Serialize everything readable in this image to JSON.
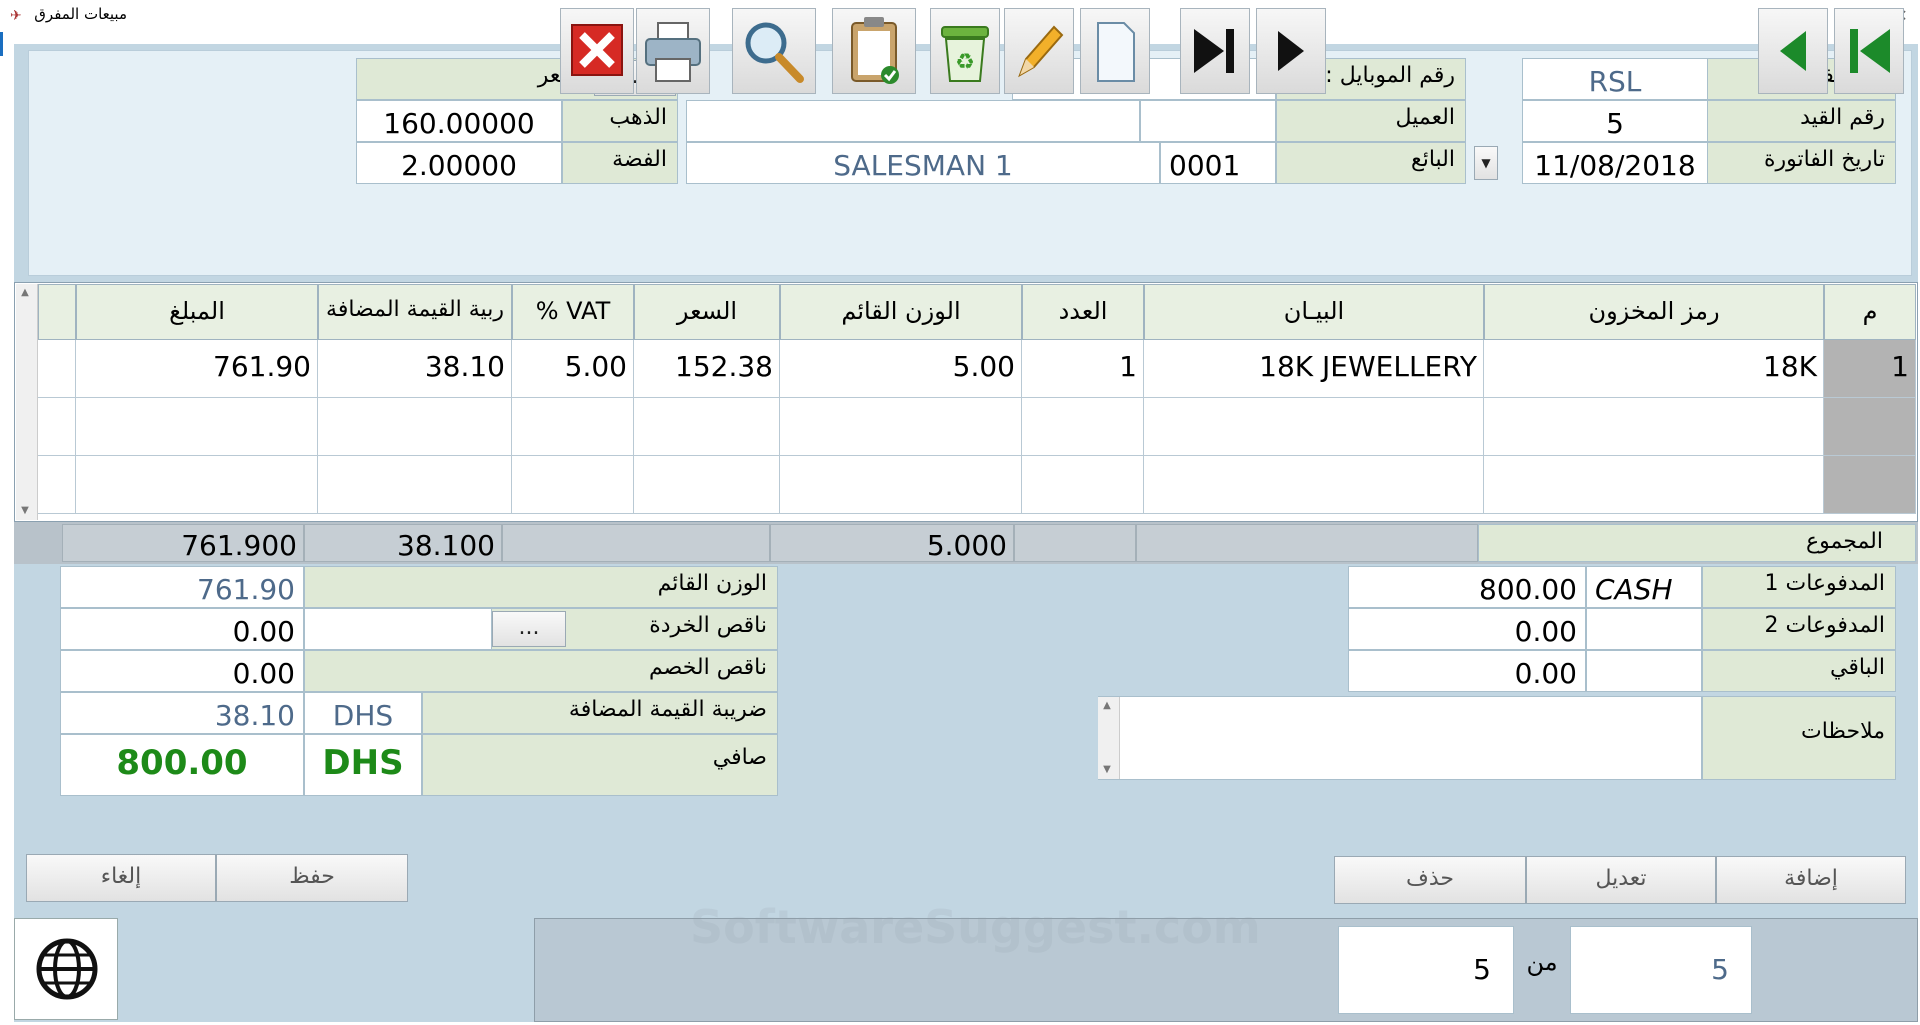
{
  "window": {
    "title": "مبيعات المفرق"
  },
  "header": {
    "invoice_type_label": "نوع الفاتورة",
    "invoice_type_value": "RSL",
    "entry_no_label": "رقم القيد",
    "entry_no_value": "5",
    "invoice_date_label": "تاريخ الفاتورة",
    "invoice_date_value": "11/08/2018",
    "mobile_label": "رقم الموبايل :",
    "mobile_value": "",
    "customer_label": "العميل",
    "customer_code": "",
    "customer_name": "",
    "seller_label": "البائع",
    "seller_code": "0001",
    "seller_name": "SALESMAN 1",
    "price_label": "السعر",
    "price_btn": "...",
    "gold_label": "الذهب",
    "gold_value": "160.00000",
    "silver_label": "الفضة",
    "silver_value": "2.00000"
  },
  "grid": {
    "columns": [
      "م",
      "رمز المخزون",
      "البيـان",
      "العدد",
      "الوزن القائم",
      "السعر",
      "VAT %",
      "ربية القيمة المضافة",
      "المبلغ"
    ],
    "rows": [
      {
        "no": "1",
        "code": "18K",
        "desc": "18K JEWELLERY",
        "qty": "1",
        "weight": "5.00",
        "price": "152.38",
        "vat_pct": "5.00",
        "vat_amt": "38.10",
        "amount": "761.90"
      },
      {
        "no": "",
        "code": "",
        "desc": "",
        "qty": "",
        "weight": "",
        "price": "",
        "vat_pct": "",
        "vat_amt": "",
        "amount": ""
      },
      {
        "no": "",
        "code": "",
        "desc": "",
        "qty": "",
        "weight": "",
        "price": "",
        "vat_pct": "",
        "vat_amt": "",
        "amount": ""
      }
    ],
    "totals": {
      "label": "المجموع",
      "weight": "5.000",
      "vat_amt": "38.100",
      "amount": "761.900"
    }
  },
  "payments": {
    "payment1_label": "المدفوعات 1",
    "payment1_method": "CASH",
    "payment1_value": "800.00",
    "payment2_label": "المدفوعات 2",
    "payment2_method": "",
    "payment2_value": "0.00",
    "remaining_label": "الباقي",
    "remaining_value": "0.00",
    "notes_label": "ملاحظات",
    "notes_value": ""
  },
  "summary": {
    "gross_weight_label": "الوزن القائم",
    "gross_weight_value": "761.90",
    "scrap_label": "ناقص الخردة",
    "scrap_value": "0.00",
    "scrap_btn": "...",
    "discount_label": "ناقص الخصم",
    "discount_value": "0.00",
    "vat_label": "ضريبة القيمة المضافة",
    "vat_currency": "DHS",
    "vat_value": "38.10",
    "net_label": "صافي",
    "net_currency": "DHS",
    "net_value": "800.00"
  },
  "actions": {
    "add": "إضافة",
    "edit": "تعديل",
    "delete": "حذف",
    "save": "حفظ",
    "cancel": "إلغاء"
  },
  "nav": {
    "current": "5",
    "of_label": "من",
    "total": "5"
  },
  "watermark": "SoftwareSuggest.com",
  "colors": {
    "accent_green": "#1d8a18",
    "panel_blue": "#c2d6e2",
    "label_green": "#dfe9d6"
  }
}
